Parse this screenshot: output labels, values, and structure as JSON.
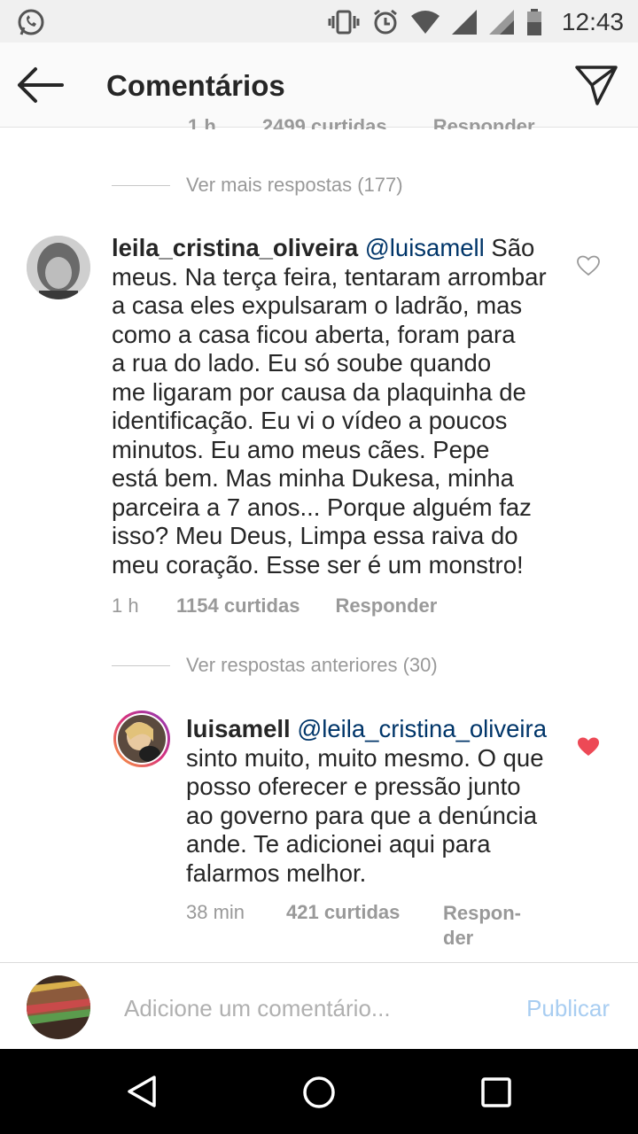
{
  "status_bar": {
    "time": "12:43"
  },
  "header": {
    "title": "Comentários"
  },
  "partial_meta": {
    "time": "1 h",
    "likes": "2499 curtidas",
    "reply": "Responder"
  },
  "more_replies_1": "Ver mais respostas (177)",
  "comment_1": {
    "username": "leila_cristina_oliveira",
    "mention": "@luisamell",
    "lines": [
      "São",
      "meus. Na terça feira, tentaram arrombar",
      "a casa eles expulsaram o ladrão, mas",
      "como a casa ficou aberta, foram para",
      "a rua do lado. Eu só soube quando",
      "me ligaram por causa da plaquinha de",
      "identificação. Eu vi o vídeo a poucos",
      "minutos. Eu amo meus cães. Pepe",
      "está bem. Mas minha Dukesa, minha",
      "parceira a 7 anos... Porque alguém faz",
      "isso? Meu Deus, Limpa essa raiva do",
      "meu coração. Esse ser é um monstro!"
    ],
    "time": "1 h",
    "likes": "1154 curtidas",
    "reply": "Responder",
    "liked": false
  },
  "previous_replies": "Ver respostas anteriores (30)",
  "comment_2": {
    "username": "luisamell",
    "mention": "@leila_cristina_oliveira",
    "lines": [
      "sinto muito, muito mesmo. O que",
      "posso oferecer e pressão junto",
      "ao governo para que a denúncia",
      "ande. Te adicionei aqui para",
      "falarmos melhor."
    ],
    "time": "38 min",
    "likes": "421 curtidas",
    "reply_line1": "Respon-",
    "reply_line2": "der",
    "liked": true
  },
  "input": {
    "placeholder": "Adicione um comentário...",
    "publish_label": "Publicar"
  },
  "colors": {
    "liked_heart": "#ed4956",
    "mention": "#003569",
    "publish": "#a8cdf1"
  }
}
